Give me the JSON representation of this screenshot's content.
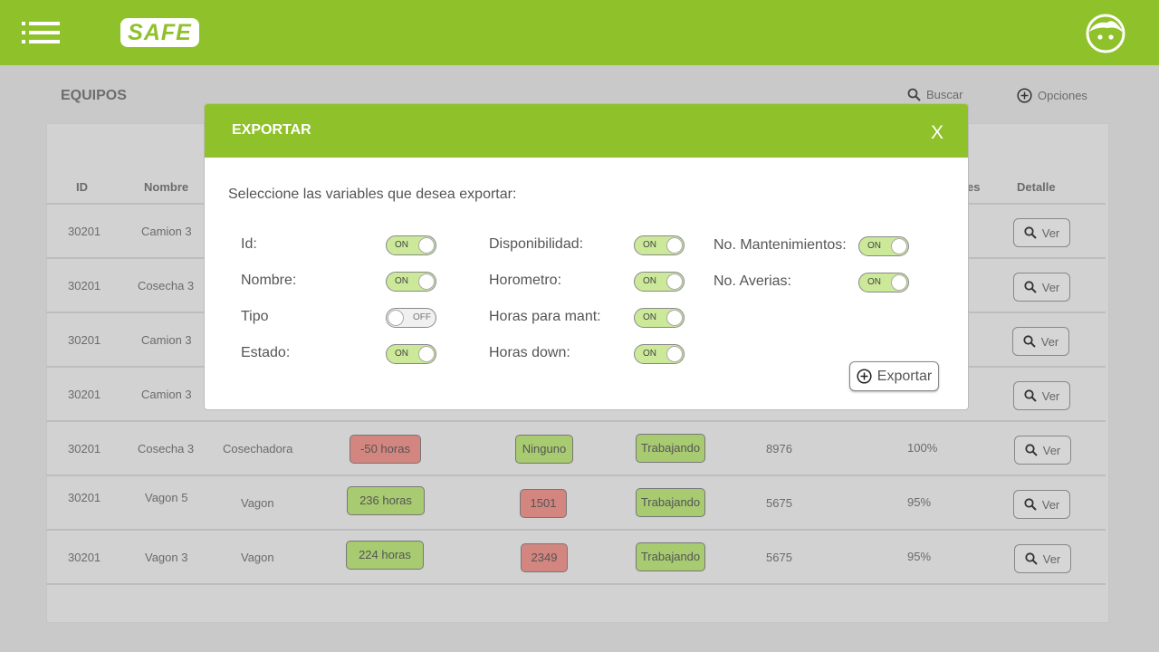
{
  "header": {
    "logo": "SAFE"
  },
  "page": {
    "title": "EQUIPOS",
    "search_label": "Buscar",
    "options_label": "Opciones"
  },
  "table": {
    "headers": {
      "id": "ID",
      "name": "Nombre",
      "fallas_fragment": "es",
      "detail": "Detalle"
    },
    "rows": [
      {
        "id": "30201",
        "name": "Camion 3"
      },
      {
        "id": "30201",
        "name": "Cosecha 3"
      },
      {
        "id": "30201",
        "name": "Camion 3"
      },
      {
        "id": "30201",
        "name": "Camion 3"
      },
      {
        "id": "30201",
        "name": "Cosecha 3",
        "type": "Cosechadora",
        "hours": "-50 horas",
        "hours_status": "red",
        "averias": "Ninguno",
        "averias_status": "green",
        "state": "Trabajando",
        "horometro": "8976",
        "disp": "100%"
      },
      {
        "id": "30201",
        "name": "Vagon 5",
        "type": "Vagon",
        "hours": "236 horas",
        "hours_status": "green",
        "averias": "1501",
        "averias_status": "red",
        "state": "Trabajando",
        "horometro": "5675",
        "disp": "95%"
      },
      {
        "id": "30201",
        "name": "Vagon 3",
        "type": "Vagon",
        "hours": "224 horas",
        "hours_status": "green",
        "averias": "2349",
        "averias_status": "red",
        "state": "Trabajando",
        "horometro": "5675",
        "disp": "95%"
      }
    ],
    "detail_label": "Ver"
  },
  "modal": {
    "title": "EXPORTAR",
    "close": "X",
    "prompt": "Seleccione las variables que desea exportar:",
    "options": [
      {
        "label": "Id:",
        "state": "ON"
      },
      {
        "label": "Nombre:",
        "state": "ON"
      },
      {
        "label": "Tipo",
        "state": "OFF"
      },
      {
        "label": "Estado:",
        "state": "ON"
      },
      {
        "label": "Disponibilidad:",
        "state": "ON"
      },
      {
        "label": "Horometro:",
        "state": "ON"
      },
      {
        "label": "Horas para mant:",
        "state": "ON"
      },
      {
        "label": "Horas down:",
        "state": "ON"
      },
      {
        "label": "No. Mantenimientos:",
        "state": "ON"
      },
      {
        "label": "No. Averias:",
        "state": "ON"
      }
    ],
    "export_label": "Exportar"
  },
  "colors": {
    "brand": "#8fc12a",
    "status_red": "#d3857f",
    "status_green": "#a8ca71",
    "overlay": "#c9c9c9"
  }
}
